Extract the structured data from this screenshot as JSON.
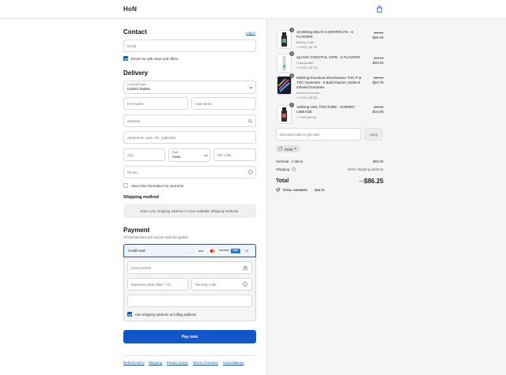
{
  "header": {
    "brand": "HoN"
  },
  "contact": {
    "title": "Contact",
    "login_link": "Log in",
    "email_placeholder": "Email",
    "news_label": "Email me with news and offers"
  },
  "delivery": {
    "title": "Delivery",
    "country_label": "Country/Region",
    "country_value": "United States",
    "first_name": "First name",
    "last_name": "Last name",
    "address": "Address",
    "apartment": "Apartment, suite, etc. (optional)",
    "city": "City",
    "state_label": "State",
    "state_value": "Iowa",
    "zip": "ZIP code",
    "phone": "Phone",
    "save_label": "Save this information for next time"
  },
  "shipping_method": {
    "title": "Shipping method",
    "message": "Enter your shipping address to view available shipping methods."
  },
  "payment": {
    "title": "Payment",
    "subtitle": "All transactions are secure and encrypted.",
    "method": "Credit card",
    "cards": [
      "VISA",
      "MC",
      "DISCOVER",
      "AMEX"
    ],
    "more_cards": "+2",
    "card_number": "Card number",
    "expiration": "Expiration date (MM / YY)",
    "security_code": "Security code",
    "billing_label": "Use shipping address as billing address",
    "pay_button": "Pay now"
  },
  "footer_links": [
    "Refund policy",
    "Shipping",
    "Privacy policy",
    "Terms of service",
    "Cancellations"
  ],
  "cart": {
    "items": [
      {
        "qty": "1",
        "name": "10,000mg DELTA 8 DROPOUTS - 6 FLAVORS",
        "variant": "Birthday Cake",
        "discount": "H025 (-$6.75)",
        "old_price": "$33.00",
        "price": "$26.25"
      },
      {
        "qty": "1",
        "name": "2g HHC COCKTAIL VAPE - 6 FLAVORS",
        "variant": "Cosmopolitan",
        "discount": "H025 (-$6.75)",
        "old_price": "$27.00",
        "price": "$20.25"
      },
      {
        "qty": "1",
        "name": "5000mg Knockout Shockwaves THC-P & THC Gummies - 6 Bold Flavors | Delta 9 Infused Gummies",
        "variant": "Electric Lemonade",
        "discount": "H025 (-$8.25)",
        "old_price": "$33.00",
        "price": "$24.75"
      },
      {
        "qty": "1",
        "name": "1000mg HHC TINCTURE - CHERRY LIMEADE",
        "variant": "",
        "discount": "H025 ($5.00)",
        "old_price": "$20.00",
        "price": "$15.00"
      }
    ],
    "discount_placeholder": "Discount code or gift card",
    "apply_button": "Apply",
    "applied_code": "H025",
    "subtotal_label": "Subtotal · 4 items",
    "subtotal_value": "$86.25",
    "shipping_label": "Shipping",
    "shipping_value": "Enter shipping address",
    "total_label": "Total",
    "currency": "USD",
    "total_value": "$86.25",
    "savings_label": "TOTAL SAVINGS",
    "savings_value": "$28.75"
  },
  "colors": {
    "accent": "#1456c9",
    "sidebar_bg": "#f5f5f5"
  }
}
